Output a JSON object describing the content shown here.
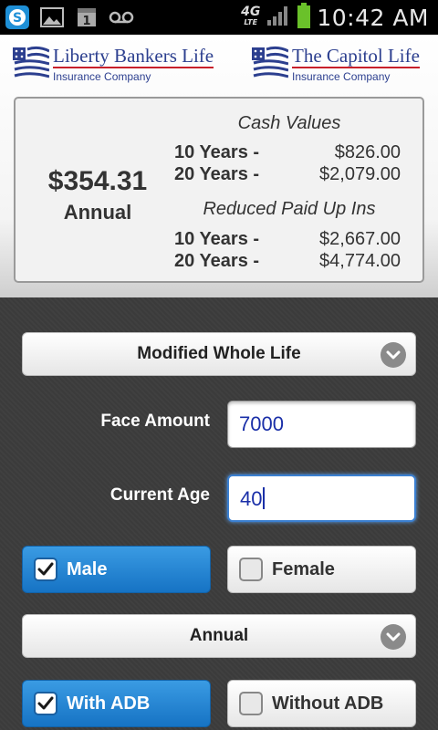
{
  "status_bar": {
    "time": "10:42 AM",
    "network": "4G",
    "network_sub": "LTE",
    "icons": [
      "skype-icon",
      "gallery-icon",
      "calendar-icon",
      "voicemail-icon"
    ]
  },
  "header": {
    "logo_left": {
      "name": "Liberty Bankers Life",
      "sub": "Insurance Company"
    },
    "logo_right": {
      "name": "The Capitol Life",
      "sub": "Insurance Company"
    }
  },
  "summary": {
    "premium": "$354.31",
    "mode": "Annual",
    "cash_values": {
      "title": "Cash Values",
      "rows": [
        {
          "label": "10 Years -",
          "value": "$826.00"
        },
        {
          "label": "20 Years -",
          "value": "$2,079.00"
        }
      ]
    },
    "reduced_paid_up": {
      "title": "Reduced Paid Up Ins",
      "rows": [
        {
          "label": "10 Years -",
          "value": "$2,667.00"
        },
        {
          "label": "20 Years -",
          "value": "$4,774.00"
        }
      ]
    }
  },
  "form": {
    "plan_select": "Modified Whole Life",
    "face_amount": {
      "label": "Face Amount",
      "value": "7000"
    },
    "current_age": {
      "label": "Current Age",
      "value": "40"
    },
    "gender": {
      "male": "Male",
      "female": "Female",
      "selected": "male"
    },
    "mode_select": "Annual",
    "adb": {
      "with": "With ADB",
      "without": "Without ADB",
      "selected": "with"
    }
  },
  "colors": {
    "accent": "#1673c4",
    "brand_blue": "#2c3f8f",
    "brand_red": "#c8202a",
    "input_text": "#1a2fa8"
  }
}
